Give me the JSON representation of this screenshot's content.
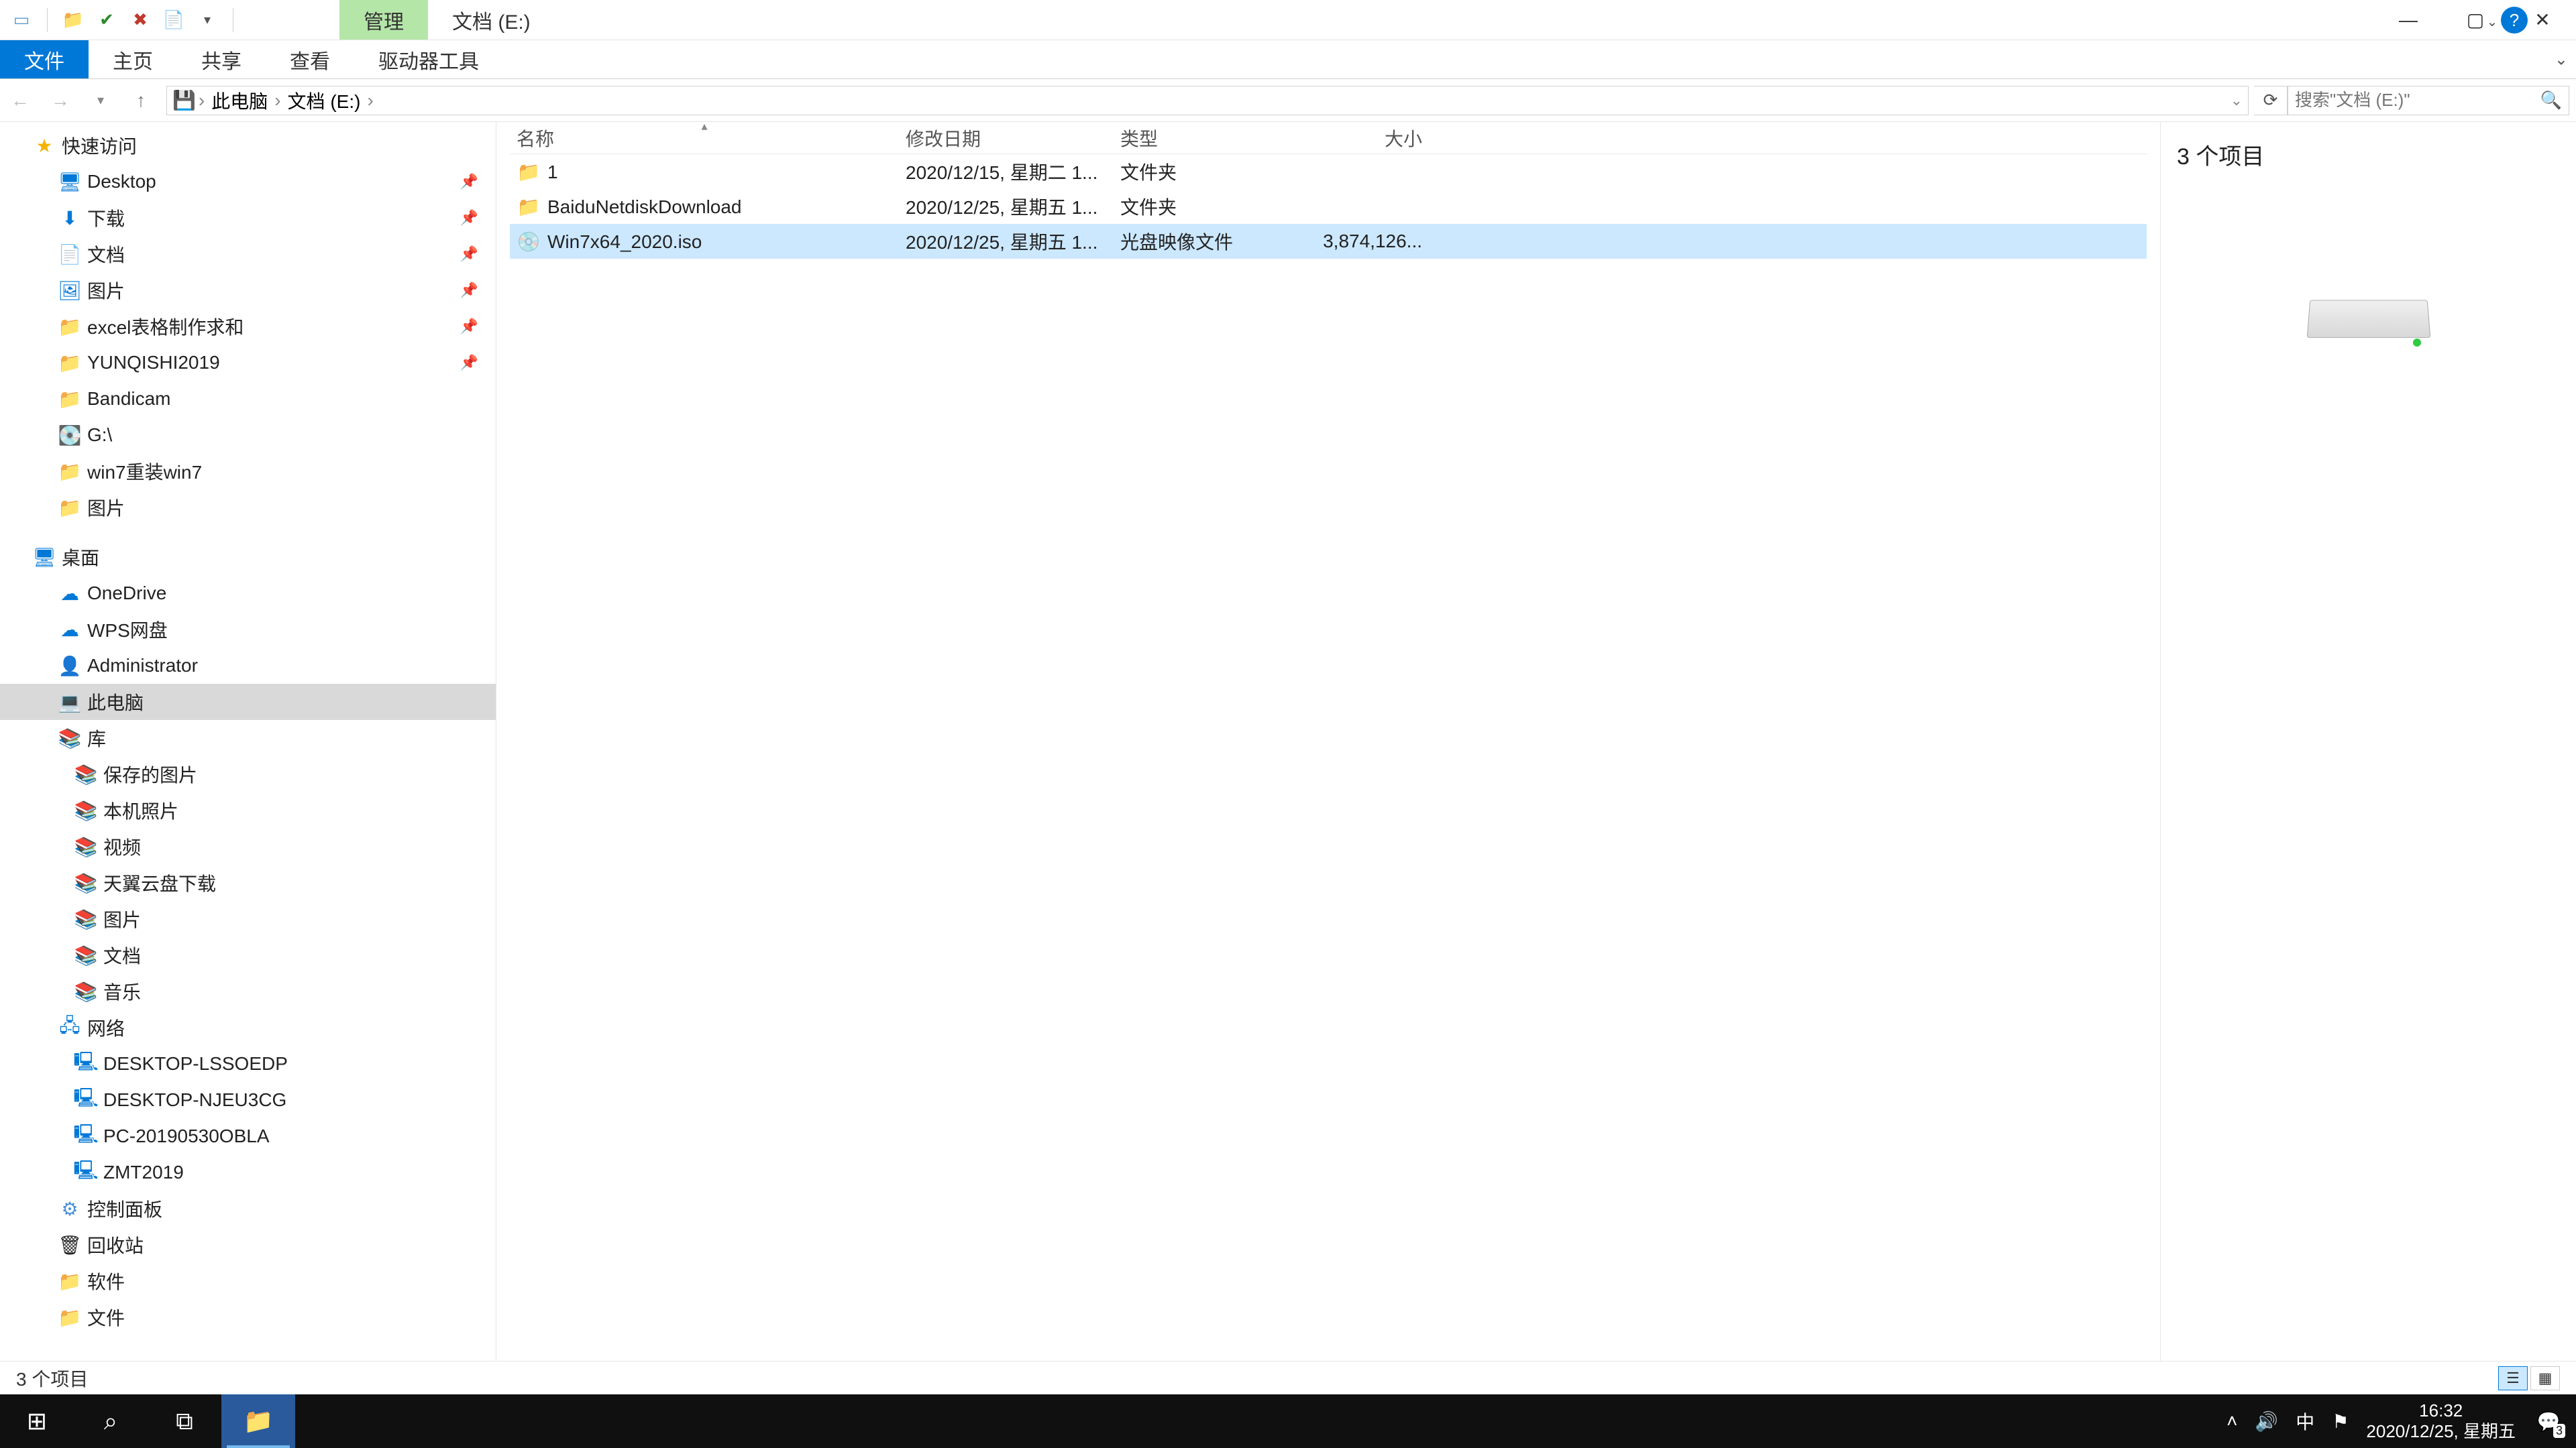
{
  "titlebar": {
    "context_tab": "管理",
    "location_tab": "文档 (E:)"
  },
  "ribbon": {
    "file": "文件",
    "home": "主页",
    "share": "共享",
    "view": "查看",
    "drive_tools": "驱动器工具"
  },
  "address": {
    "crumbs": [
      "此电脑",
      "文档 (E:)"
    ],
    "search_placeholder": "搜索\"文档 (E:)\""
  },
  "sidebar": {
    "quick_access": "快速访问",
    "quick_items": [
      {
        "label": "Desktop",
        "icon": "desktop",
        "color": "#0078d7",
        "pinned": true
      },
      {
        "label": "下载",
        "icon": "download",
        "color": "#0078d7",
        "pinned": true
      },
      {
        "label": "文档",
        "icon": "doc",
        "color": "#0078d7",
        "pinned": true
      },
      {
        "label": "图片",
        "icon": "pic",
        "color": "#0078d7",
        "pinned": true
      },
      {
        "label": "excel表格制作求和",
        "icon": "folder",
        "color": "#f8d775",
        "pinned": true
      },
      {
        "label": "YUNQISHI2019",
        "icon": "folder",
        "color": "#f8d775",
        "pinned": true
      },
      {
        "label": "Bandicam",
        "icon": "folder",
        "color": "#f8d775",
        "pinned": false
      },
      {
        "label": "G:\\",
        "icon": "drive",
        "color": "#7aa7d8",
        "pinned": false
      },
      {
        "label": "win7重装win7",
        "icon": "folder",
        "color": "#f8d775",
        "pinned": false
      },
      {
        "label": "图片",
        "icon": "folder",
        "color": "#f8d775",
        "pinned": false
      }
    ],
    "desktop": "桌面",
    "desktop_items": [
      {
        "label": "OneDrive",
        "icon": "cloud"
      },
      {
        "label": "WPS网盘",
        "icon": "cloud"
      },
      {
        "label": "Administrator",
        "icon": "user"
      },
      {
        "label": "此电脑",
        "icon": "pc",
        "selected": true
      },
      {
        "label": "库",
        "icon": "lib"
      }
    ],
    "library_items": [
      {
        "label": "保存的图片"
      },
      {
        "label": "本机照片"
      },
      {
        "label": "视频"
      },
      {
        "label": "天翼云盘下载"
      },
      {
        "label": "图片"
      },
      {
        "label": "文档"
      },
      {
        "label": "音乐"
      }
    ],
    "network": "网络",
    "network_items": [
      {
        "label": "DESKTOP-LSSOEDP"
      },
      {
        "label": "DESKTOP-NJEU3CG"
      },
      {
        "label": "PC-20190530OBLA"
      },
      {
        "label": "ZMT2019"
      }
    ],
    "control_panel": "控制面板",
    "recycle_bin": "回收站",
    "software": "软件",
    "wendang": "文件"
  },
  "columns": {
    "name": "名称",
    "date": "修改日期",
    "type": "类型",
    "size": "大小"
  },
  "files": [
    {
      "name": "1",
      "date": "2020/12/15, 星期二 1...",
      "type": "文件夹",
      "size": "",
      "icon": "folder"
    },
    {
      "name": "BaiduNetdiskDownload",
      "date": "2020/12/25, 星期五 1...",
      "type": "文件夹",
      "size": "",
      "icon": "folder"
    },
    {
      "name": "Win7x64_2020.iso",
      "date": "2020/12/25, 星期五 1...",
      "type": "光盘映像文件",
      "size": "3,874,126...",
      "icon": "iso",
      "selected": true
    }
  ],
  "preview": {
    "count_label": "3 个项目"
  },
  "statusbar": {
    "item_count": "3 个项目"
  },
  "taskbar": {
    "time": "16:32",
    "date": "2020/12/25, 星期五",
    "ime": "中",
    "notif_count": "3"
  }
}
